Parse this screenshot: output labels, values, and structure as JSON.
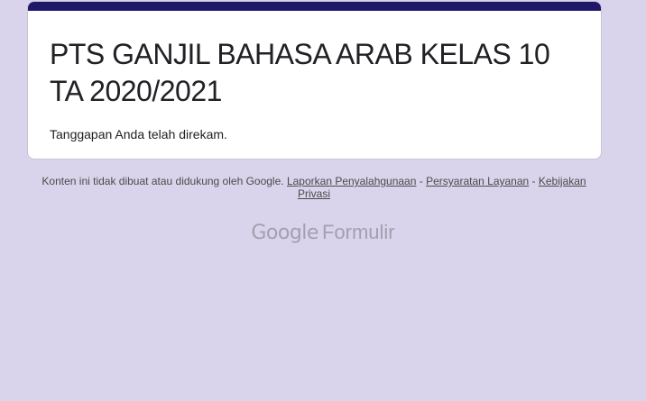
{
  "form": {
    "title": "PTS GANJIL BAHASA ARAB KELAS 10 TA 2020/2021",
    "confirmation": "Tanggapan Anda telah direkam.",
    "accent_color": "#1f1767"
  },
  "footer": {
    "disclaimer": "Konten ini tidak dibuat atau didukung oleh Google.",
    "report_abuse": "Laporkan Penyalahgunaan",
    "separator": "-",
    "terms": "Persyaratan Layanan",
    "privacy": "Kebijakan Privasi"
  },
  "brand": {
    "google": "Google",
    "product": "Formulir"
  },
  "colors": {
    "background": "#d9d4ec"
  }
}
